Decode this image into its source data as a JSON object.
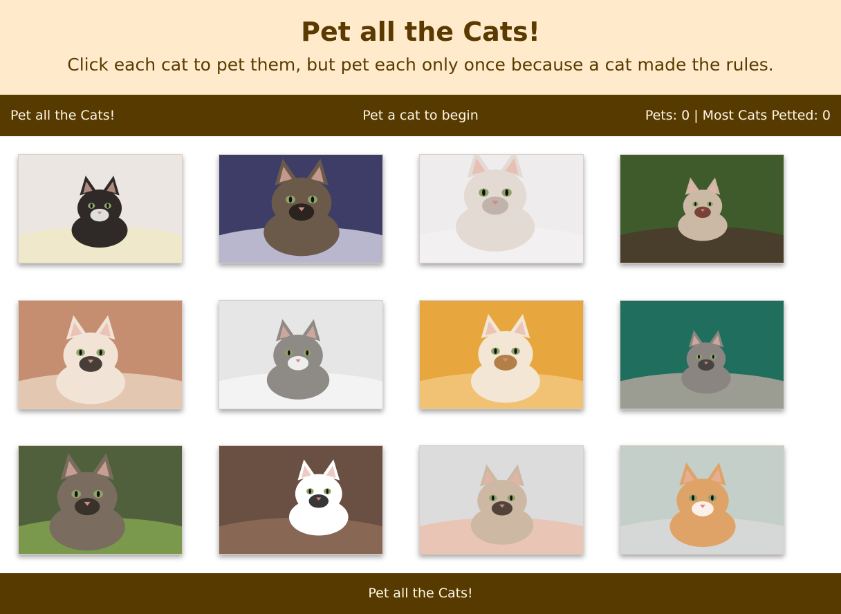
{
  "header": {
    "title": "Pet all the Cats!",
    "subtitle": "Click each cat to pet them, but pet each only once because a cat made the rules."
  },
  "status_bar": {
    "title": "Pet all the Cats!",
    "message": "Pet a cat to begin",
    "score": "Pets: 0 | Most Cats Petted: 0"
  },
  "cats": [
    {
      "name": "black-white-kitten",
      "bg": "#ece6e2",
      "fur": "#2f2a28",
      "accent": "#ffffff",
      "ground": "#efe8c8"
    },
    {
      "name": "tabby-kitten-blanket",
      "bg": "#3e3d68",
      "fur": "#6b5a4a",
      "accent": "#1f1a16",
      "ground": "#c7c4d8"
    },
    {
      "name": "white-persian-cat",
      "bg": "#efeced",
      "fur": "#e3dad3",
      "accent": "#b8aba3",
      "ground": "#f3f1f1"
    },
    {
      "name": "kitten-in-garden",
      "bg": "#3f5a2b",
      "fur": "#cbb9a6",
      "accent": "#6a2e23",
      "ground": "#4a3a2c"
    },
    {
      "name": "calico-kitten-box",
      "bg": "#c58e70",
      "fur": "#f1e3d6",
      "accent": "#2a211c",
      "ground": "#e7cdb8"
    },
    {
      "name": "grey-white-kitten-bed",
      "bg": "#e6e6e6",
      "fur": "#8e8a85",
      "accent": "#ffffff",
      "ground": "#f4f4f4"
    },
    {
      "name": "kitten-orange-background",
      "bg": "#e8a73e",
      "fur": "#f3e6d5",
      "accent": "#a86b2e",
      "ground": "#f3c57a"
    },
    {
      "name": "grey-kitten-on-deck",
      "bg": "#1f6e5e",
      "fur": "#8a8580",
      "accent": "#3a3836",
      "ground": "#a8a299"
    },
    {
      "name": "long-haired-tabby",
      "bg": "#51603c",
      "fur": "#7a6d5f",
      "accent": "#2e2822",
      "ground": "#7fa04e"
    },
    {
      "name": "black-white-cat-rocks",
      "bg": "#6a4f43",
      "fur": "#ffffff",
      "accent": "#151313",
      "ground": "#8c6a58"
    },
    {
      "name": "siamese-kitten-blanket",
      "bg": "#dcdcdc",
      "fur": "#cdb8a4",
      "accent": "#3b2e27",
      "ground": "#eac2b0"
    },
    {
      "name": "orange-cat-window",
      "bg": "#c3cfc8",
      "fur": "#e0a367",
      "accent": "#ffffff",
      "ground": "#d8d8d8"
    }
  ],
  "footer": {
    "text": "Pet all the Cats!"
  }
}
